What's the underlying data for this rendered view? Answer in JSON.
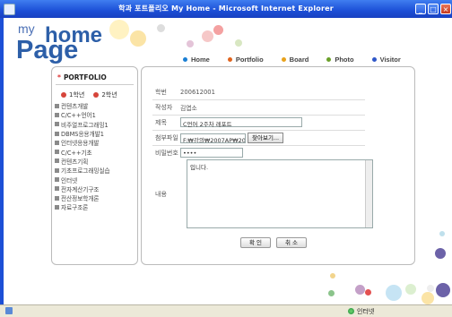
{
  "window": {
    "title": "학과 포트폴리오 My Home - Microsoft Internet Explorer",
    "controls": [
      "_",
      "□",
      "×"
    ]
  },
  "status": {
    "zone": "인터넷"
  },
  "logo": {
    "my": "my",
    "home": "home",
    "page": "Page"
  },
  "nav": [
    {
      "label": "Home",
      "color": "#1a7fd4"
    },
    {
      "label": "Portfolio",
      "color": "#e0641e"
    },
    {
      "label": "Board",
      "color": "#e8a21c"
    },
    {
      "label": "Photo",
      "color": "#6aa02a"
    },
    {
      "label": "Visitor",
      "color": "#2f57c8"
    }
  ],
  "sidebar": {
    "title": "PORTFOLIO",
    "years": [
      "1학년",
      "2학년"
    ],
    "items": [
      "컨텐츠개발",
      "C/C++언어1",
      "비주얼프로그래밍1",
      "DBMS응용개발1",
      "인터넷응용개발",
      "C/C++기초",
      "컨텐츠기획",
      "기초프로그래밍실습",
      "인터넷",
      "전자계산기구조",
      "전산정보학개론",
      "자료구조론"
    ]
  },
  "form": {
    "student_id_label": "학번",
    "student_id": "200612001",
    "author_label": "작성자",
    "author": "김엽소",
    "subject_label": "제목",
    "subject": "C언어 2주차 레포트",
    "attach_label": "첨부파일",
    "attach": "F:₩강의₩2007AP₩20(",
    "browse_label": "찾아보기...",
    "password_label": "비밀번호",
    "password": "••••",
    "content_label": "내용",
    "content": "입니다.",
    "confirm_label": "확 인",
    "cancel_label": "취 소"
  }
}
